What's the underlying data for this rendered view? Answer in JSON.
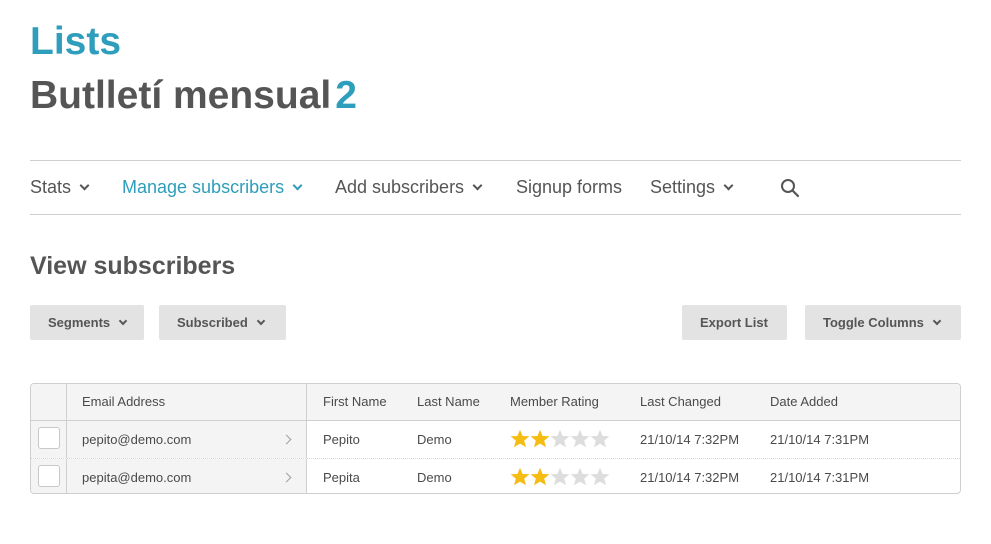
{
  "header": {
    "section": "Lists",
    "list_name": "Butlletí mensual",
    "list_count": "2"
  },
  "nav": {
    "items": [
      {
        "label": "Stats",
        "has_dropdown": true,
        "active": false
      },
      {
        "label": "Manage subscribers",
        "has_dropdown": true,
        "active": true
      },
      {
        "label": "Add subscribers",
        "has_dropdown": true,
        "active": false
      },
      {
        "label": "Signup forms",
        "has_dropdown": false,
        "active": false
      },
      {
        "label": "Settings",
        "has_dropdown": true,
        "active": false
      }
    ],
    "search_icon": "search-icon"
  },
  "main": {
    "heading": "View subscribers",
    "toolbar": {
      "segments_label": "Segments",
      "subscribed_label": "Subscribed",
      "export_label": "Export List",
      "toggle_columns_label": "Toggle Columns"
    }
  },
  "table": {
    "columns": [
      "Email Address",
      "First Name",
      "Last Name",
      "Member Rating",
      "Last Changed",
      "Date Added"
    ],
    "rows": [
      {
        "email": "pepito@demo.com",
        "first_name": "Pepito",
        "last_name": "Demo",
        "rating": 2,
        "rating_max": 5,
        "last_changed": "21/10/14 7:32PM",
        "date_added": "21/10/14 7:31PM"
      },
      {
        "email": "pepita@demo.com",
        "first_name": "Pepita",
        "last_name": "Demo",
        "rating": 2,
        "rating_max": 5,
        "last_changed": "21/10/14 7:32PM",
        "date_added": "21/10/14 7:31PM"
      }
    ]
  },
  "colors": {
    "accent": "#2e9ebc",
    "text": "#555555",
    "star_on": "#f5bd14",
    "star_off": "#dddddd"
  }
}
